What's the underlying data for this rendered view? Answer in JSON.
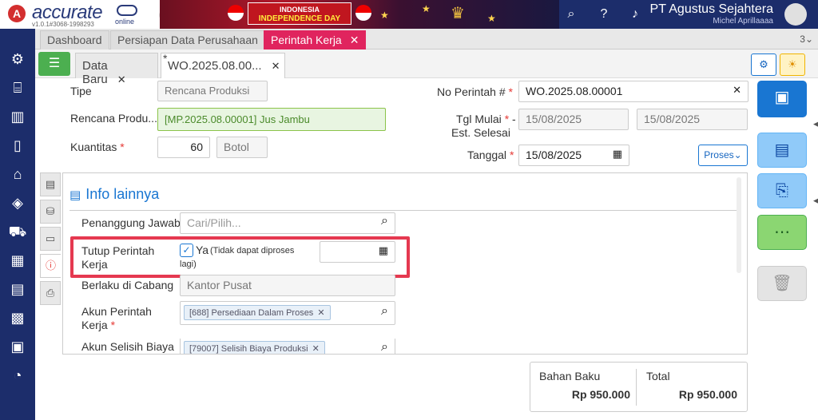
{
  "app": {
    "logo_letter": "A",
    "logo_text": "accurate",
    "logo_sub": "online",
    "version": "v1.0.1#3068-1998293"
  },
  "banner": {
    "line1": "INDONESIA",
    "line2": "INDEPENDENCE DAY"
  },
  "header": {
    "company": "PT Agustus Sejahtera",
    "user": "Michel Aprillaaaa"
  },
  "tabs": [
    {
      "label": "Dashboard"
    },
    {
      "label": "Persiapan Data Perusahaan"
    },
    {
      "label": "Perintah Kerja",
      "close": "✕"
    }
  ],
  "tab_count": "3⌄",
  "subtabs": [
    {
      "label": "Data Baru",
      "close": "✕"
    },
    {
      "label": "WO.2025.08.00...",
      "close": "✕",
      "modified": "*"
    }
  ],
  "form": {
    "tipe_label": "Tipe",
    "tipe_value": "Rencana Produksi",
    "rencana_label": "Rencana Produ...",
    "rencana_value": "[MP.2025.08.00001] Jus Jambu",
    "kuantitas_label": "Kuantitas",
    "kuantitas_value": "60",
    "kuantitas_unit": "Botol",
    "no_label": "No Perintah #",
    "no_value": "WO.2025.08.00001",
    "tgl_mulai_label": "Tgl Mulai",
    "est_label": "Est. Selesai",
    "tgl_mulai_value": "15/08/2025",
    "est_value": "15/08/2025",
    "tanggal_label": "Tanggal",
    "tanggal_value": "15/08/2025",
    "proses_label": "Proses⌄",
    "required": "*",
    "dash": "-"
  },
  "info": {
    "title": "Info lainnya",
    "pj_label": "Penanggung Jawab",
    "pj_placeholder": "Cari/Pilih...",
    "tutup_label1": "Tutup Perintah",
    "tutup_label2": "Kerja",
    "tutup_check": "✓",
    "tutup_ya": "Ya",
    "tutup_note1": "(Tidak dapat diproses",
    "tutup_note2": "lagi)",
    "cabang_label": "Berlaku di Cabang",
    "cabang_value": "Kantor Pusat",
    "akun_label1": "Akun Perintah",
    "akun_label2": "Kerja",
    "akun_value": "[688] Persediaan Dalam Proses",
    "selisih_label": "Akun Selisih Biaya",
    "selisih_value": "[79007] Selisih Biaya Produksi",
    "chip_x": "✕"
  },
  "totals": {
    "bahan_label": "Bahan Baku",
    "bahan_value": "Rp 950.000",
    "total_label": "Total",
    "total_value": "Rp 950.000"
  },
  "icons": {
    "search": "⌕",
    "close": "✕",
    "calendar": "▦",
    "gear": "⚙",
    "bulb": "☀",
    "save": "▣",
    "doc": "▤",
    "clip": "⎘",
    "more": "⋯",
    "trash": "🗑"
  },
  "colors": {
    "nav": "#1c2d6b",
    "active_tab": "#e0245e",
    "primary": "#1976d2",
    "highlight": "#e53950"
  }
}
